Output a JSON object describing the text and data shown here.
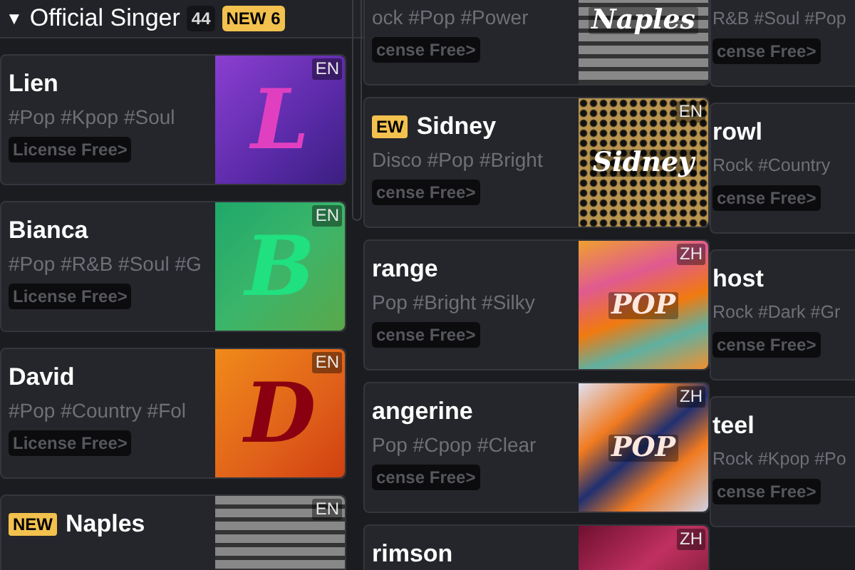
{
  "header": {
    "toggle": "▼",
    "title": "Official Singer",
    "count": "44",
    "new_badge": "NEW 6"
  },
  "columns": [
    {
      "cards": [
        {
          "name": "Lien",
          "is_new": false,
          "tags": "#Pop #Kpop #Soul",
          "license": "License Free>",
          "cover": {
            "kind": "purple",
            "art": "L",
            "lang": "EN"
          }
        },
        {
          "name": "Bianca",
          "is_new": false,
          "tags": "#Pop #R&B #Soul #G",
          "license": "License Free>",
          "cover": {
            "kind": "green",
            "art": "B",
            "lang": "EN"
          }
        },
        {
          "name": "David",
          "is_new": false,
          "tags": "#Pop #Country #Fol",
          "license": "License Free>",
          "cover": {
            "kind": "orange",
            "art": "D",
            "lang": "EN"
          }
        },
        {
          "name": "Naples",
          "is_new": true,
          "new_label": "NEW",
          "cover": {
            "kind": "bricks",
            "lang": "EN"
          }
        }
      ]
    },
    {
      "cards": [
        {
          "tags": "ock #Pop #Power",
          "license": "cense Free>",
          "cover": {
            "kind": "bricks",
            "art": "Naples"
          }
        },
        {
          "name": "Sidney",
          "is_new": true,
          "new_label": "EW",
          "tags": "Disco #Pop #Bright",
          "license": "cense Free>",
          "cover": {
            "kind": "honeycomb",
            "art": "Sidney",
            "lang": "EN"
          }
        },
        {
          "name": "range",
          "is_new": false,
          "tags": "Pop #Bright #Silky",
          "license": "cense Free>",
          "cover": {
            "kind": "fluid-orange",
            "art": "POP",
            "lang": "ZH"
          }
        },
        {
          "name": "angerine",
          "is_new": false,
          "tags": "Pop #Cpop #Clear",
          "license": "cense Free>",
          "cover": {
            "kind": "fluid-blue",
            "art": "POP",
            "lang": "ZH"
          }
        },
        {
          "name": "rimson",
          "is_new": false,
          "cover": {
            "kind": "fluid-red",
            "lang": "ZH"
          }
        }
      ]
    },
    {
      "cards": [
        {
          "tags": "R&B #Soul #Pop",
          "license": "cense Free>"
        },
        {
          "name": "rowl",
          "is_new": false,
          "tags": "Rock #Country",
          "license": "cense Free>"
        },
        {
          "name": "host",
          "is_new": false,
          "tags": "Rock #Dark #Gr",
          "license": "cense Free>"
        },
        {
          "name": "teel",
          "is_new": false,
          "tags": "Rock #Kpop #Po",
          "license": "cense Free>"
        }
      ]
    }
  ]
}
